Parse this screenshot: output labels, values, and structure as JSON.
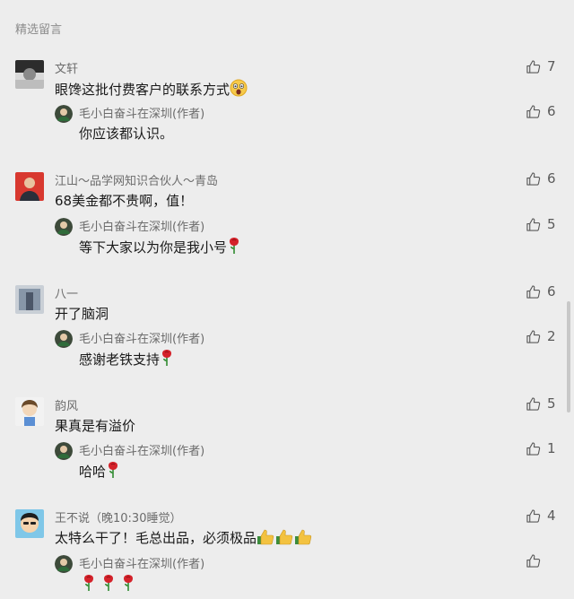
{
  "section_title": "精选留言",
  "colors": {
    "background": "#ededed",
    "text": "#191919",
    "nick": "#6b6b6b",
    "like": "#5a5a5a"
  },
  "comments": [
    {
      "nick": "文轩",
      "text": "眼馋这批付费客户的联系方式",
      "emoji": "scream-face-icon",
      "likes": "7",
      "reply": {
        "nick": "毛小白奋斗在深圳(作者)",
        "text": "你应该都认识。",
        "likes": "6"
      }
    },
    {
      "nick": "江山～品学网知识合伙人～青岛",
      "text": "68美金都不贵啊，值！",
      "likes": "6",
      "reply": {
        "nick": "毛小白奋斗在深圳(作者)",
        "text": "等下大家以为你是我小号",
        "emoji": "rose-icon",
        "likes": "5"
      }
    },
    {
      "nick": "八一",
      "text": "开了脑洞",
      "likes": "6",
      "reply": {
        "nick": "毛小白奋斗在深圳(作者)",
        "text": "感谢老铁支持",
        "emoji": "rose-icon",
        "likes": "2"
      }
    },
    {
      "nick": "韵风",
      "text": "果真是有溢价",
      "likes": "5",
      "reply": {
        "nick": "毛小白奋斗在深圳(作者)",
        "text": "哈哈",
        "emoji": "rose-icon",
        "likes": "1"
      }
    },
    {
      "nick": "王不说（晚10:30睡觉）",
      "text": "太特么干了！毛总出品，必须极品",
      "emoji": "thumbs-up-icon x3",
      "likes": "4",
      "reply": {
        "nick": "毛小白奋斗在深圳(作者)",
        "text": "",
        "emoji": "rose-icon x3",
        "likes": ""
      }
    }
  ]
}
